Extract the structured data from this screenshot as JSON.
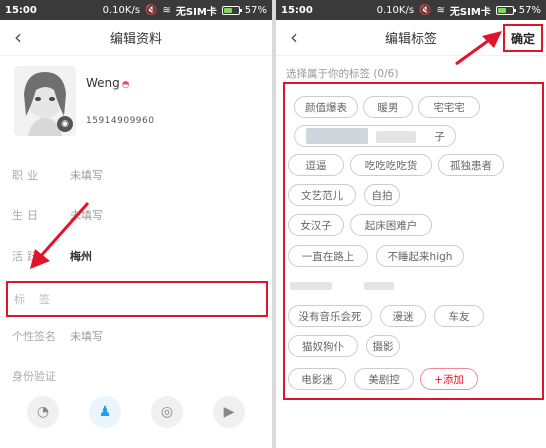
{
  "status": {
    "time": "15:00",
    "speed": "0.10K/s",
    "sim": "无SIM卡",
    "battery": "57%",
    "battery_level": 0.57
  },
  "left": {
    "title": "编辑资料",
    "back": "‹",
    "profile": {
      "name": "Weng",
      "phone": "15914909960"
    },
    "rows": {
      "job": {
        "label": "职业",
        "value": "未填写"
      },
      "birthday": {
        "label": "生日",
        "value": "未填写"
      },
      "active_area": {
        "label": "活跃",
        "value": "梅州"
      },
      "tags": {
        "label": "标签"
      },
      "signature": {
        "label": "个性签名",
        "value": "未填写"
      },
      "identity": {
        "label": "身份验证"
      }
    }
  },
  "right": {
    "title": "编辑标签",
    "back": "‹",
    "confirm": "确定",
    "hint": "选择属于你的标签 (0/6)",
    "tags": [
      "颜值爆表",
      "暖男",
      "宅宅宅",
      "子",
      "逗逼",
      "吃吃吃吃货",
      "孤独患者",
      "文艺范儿",
      "自拍",
      "女汉子",
      "起床困难户",
      "一直在路上",
      "不睡起来high",
      "没有音乐会死",
      "漫迷",
      "车友",
      "猫奴狗仆",
      "摄影",
      "电影迷",
      "美剧控"
    ],
    "add": "+添加"
  },
  "icons": {
    "signal": "signal-icon",
    "wifi": "wifi-icon",
    "mute": "mute-icon",
    "wechat": "wechat-icon",
    "qq": "qq-icon",
    "weibo": "weibo-icon",
    "video": "video-camera-icon"
  },
  "colors": {
    "accent": "#e0142b",
    "status_bar": "#3a3a3a"
  }
}
